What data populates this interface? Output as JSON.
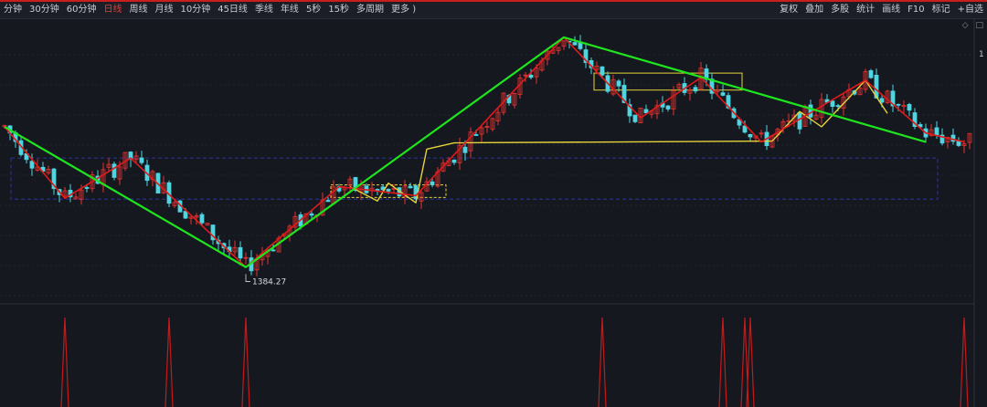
{
  "toolbar": {
    "periods": [
      {
        "label": "分钟",
        "active": false
      },
      {
        "label": "30分钟",
        "active": false
      },
      {
        "label": "60分钟",
        "active": false
      },
      {
        "label": "日线",
        "active": true
      },
      {
        "label": "周线",
        "active": false
      },
      {
        "label": "月线",
        "active": false
      },
      {
        "label": "10分钟",
        "active": false
      },
      {
        "label": "45日线",
        "active": false
      },
      {
        "label": "季线",
        "active": false
      },
      {
        "label": "年线",
        "active": false
      },
      {
        "label": "5秒",
        "active": false
      },
      {
        "label": "15秒",
        "active": false
      },
      {
        "label": "多周期",
        "active": false
      },
      {
        "label": "更多 )",
        "active": false
      }
    ],
    "right_tools": [
      "复权",
      "叠加",
      "多股",
      "统计",
      "画线",
      "F10",
      "标记",
      "+自选"
    ],
    "axis_edge_label": "1"
  },
  "colors": {
    "up": "#e8322f",
    "down": "#4fd4e0",
    "trend_main": "#1ee51e",
    "trend_mid": "#e01b1b",
    "trend_minor": "#e6d23a",
    "box_minor": "#e6d23a",
    "box_major": "#28308a",
    "signal": "#c41a1a"
  },
  "chart_data": {
    "type": "candlestick",
    "annotations": [
      {
        "label": "1384.27",
        "at": "pivot-low"
      }
    ],
    "price_range": [
      1350,
      1650
    ],
    "low_value": 1384.27,
    "pivots_main": [
      {
        "i": 0,
        "p": 1545
      },
      {
        "i": 44,
        "p": 1388
      },
      {
        "i": 102,
        "p": 1645
      },
      {
        "i": 168,
        "p": 1528
      }
    ],
    "pivots_mid": [
      {
        "i": 0,
        "p": 1545
      },
      {
        "i": 11,
        "p": 1465
      },
      {
        "i": 23,
        "p": 1510
      },
      {
        "i": 44,
        "p": 1388
      },
      {
        "i": 61,
        "p": 1478
      },
      {
        "i": 75,
        "p": 1468
      },
      {
        "i": 102,
        "p": 1645
      },
      {
        "i": 116,
        "p": 1555
      },
      {
        "i": 127,
        "p": 1600
      },
      {
        "i": 138,
        "p": 1528
      },
      {
        "i": 157,
        "p": 1597
      },
      {
        "i": 168,
        "p": 1538
      },
      {
        "i": 175,
        "p": 1528
      }
    ],
    "pivots_minor": [
      {
        "i": 63,
        "p": 1478
      },
      {
        "i": 68,
        "p": 1462
      },
      {
        "i": 70,
        "p": 1482
      },
      {
        "i": 75,
        "p": 1460
      },
      {
        "i": 77,
        "p": 1520
      },
      {
        "i": 82,
        "p": 1527
      },
      {
        "i": 140,
        "p": 1529
      },
      {
        "i": 145,
        "p": 1562
      },
      {
        "i": 149,
        "p": 1545
      },
      {
        "i": 157,
        "p": 1597
      },
      {
        "i": 161,
        "p": 1560
      }
    ],
    "boxes_minor": [
      {
        "i1": 60,
        "i2": 81,
        "p1": 1480,
        "p2": 1466
      },
      {
        "i1": 108,
        "i2": 135,
        "p1": 1605,
        "p2": 1586
      }
    ],
    "box_major": {
      "i1": 1,
      "i2": 170,
      "p1": 1510,
      "p2": 1464
    },
    "signal_spikes": [
      11,
      30,
      44,
      109,
      131,
      135,
      136,
      175
    ]
  }
}
